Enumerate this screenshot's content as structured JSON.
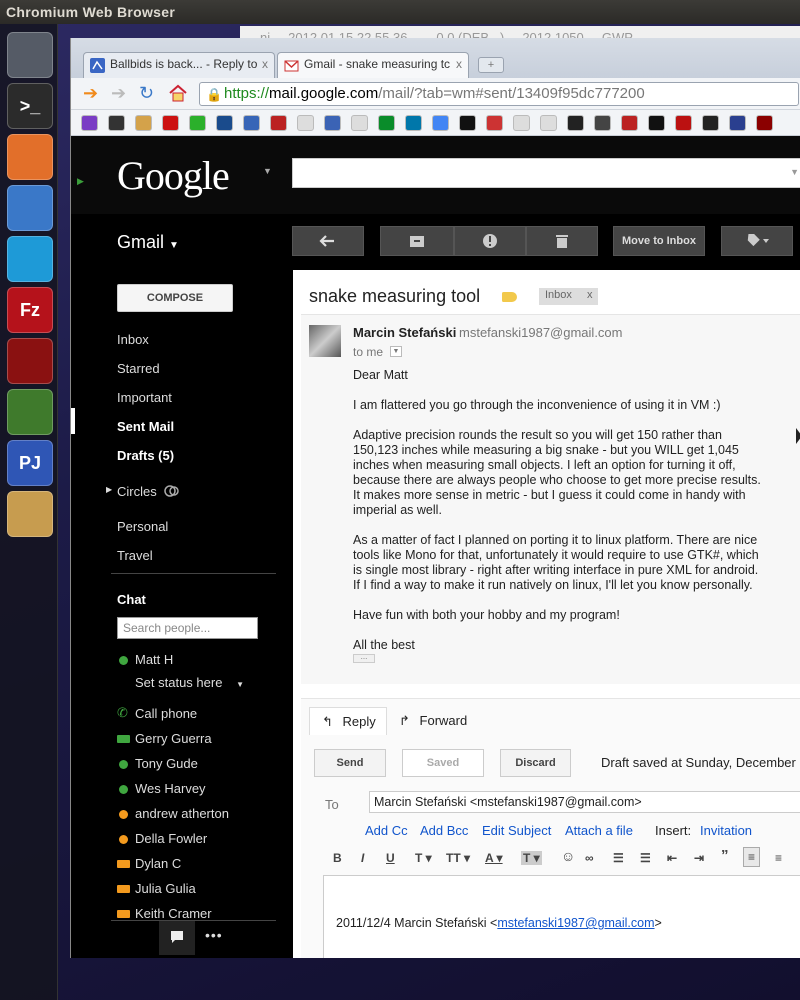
{
  "desktop": {
    "panel_title": "Chromium Web Browser",
    "launcher": [
      {
        "name": "ubuntu-dash-icon",
        "color": "#555b66"
      },
      {
        "name": "terminal-icon",
        "color": "#2b2b2b"
      },
      {
        "name": "home-folder-icon",
        "color": "#e26f2a"
      },
      {
        "name": "chromium-icon",
        "color": "#3a78c8"
      },
      {
        "name": "skype-icon",
        "color": "#1e9ad7"
      },
      {
        "name": "filezilla-icon",
        "color": "#b5121b"
      },
      {
        "name": "crossover-icon",
        "color": "#8a1111"
      },
      {
        "name": "josm-icon",
        "color": "#3f7a2c"
      },
      {
        "name": "pj64-icon",
        "color": "#2f56b5"
      },
      {
        "name": "gimp-icon",
        "color": "#c79c4f"
      }
    ],
    "launcher_labels": {
      "terminal": ">_",
      "filezilla": "Fz",
      "pj64": "PJ"
    },
    "bg_window_text": "ni ... 2012 01 15 22 55 36 ...... 0.0 (DEB...) ... 2012 1050 ... GWP"
  },
  "browser": {
    "tabs": [
      {
        "title": "Ballbids is back... - Reply to",
        "close": "x",
        "active": false
      },
      {
        "title": "Gmail - snake measuring tc",
        "close": "x",
        "active": true
      }
    ],
    "url": {
      "scheme": "https://",
      "host": "mail.google.com",
      "path": "/mail/?tab=wm#sent/13409f95dc777200"
    },
    "bookmark_colors": [
      "#7a3cc4",
      "#333",
      "#d4a24a",
      "#cc1111",
      "#2bb02b",
      "#1a4b8c",
      "#3765b7",
      "#b22",
      "#ddd",
      "#3b63b5",
      "#ddd",
      "#0a8c2a",
      "#07a",
      "#4285f4",
      "#111",
      "#c33",
      "#ddd",
      "#ddd",
      "#222",
      "#444",
      "#b22",
      "#111",
      "#b11",
      "#222",
      "#2a3f8f",
      "#8b0000"
    ]
  },
  "gmail": {
    "logo": "Google",
    "app_name": "Gmail",
    "search_placeholder": "",
    "actions": {
      "reply_icon": "reply-icon",
      "archive_icon": "archive-icon",
      "spam_icon": "report-spam-icon",
      "delete_icon": "delete-icon",
      "move_to_inbox": "Move to Inbox",
      "labels_icon": "label-tag-icon"
    },
    "nav": {
      "compose": "COMPOSE",
      "items": [
        {
          "label": "Inbox"
        },
        {
          "label": "Starred"
        },
        {
          "label": "Important"
        },
        {
          "label": "Sent Mail"
        },
        {
          "label": "Drafts (5)"
        },
        {
          "label": "Circles"
        },
        {
          "label": "Personal"
        },
        {
          "label": "Travel"
        }
      ],
      "chat_title": "Chat",
      "chat_search_placeholder": "Search people...",
      "self_name": "Matt H",
      "set_status": "Set status here",
      "call_phone": "Call phone",
      "contacts": [
        {
          "name": "Gerry Guerra",
          "status": "video-green"
        },
        {
          "name": "Tony Gude",
          "status": "green"
        },
        {
          "name": "Wes Harvey",
          "status": "green"
        },
        {
          "name": "andrew atherton",
          "status": "orange"
        },
        {
          "name": "Della Fowler",
          "status": "orange"
        },
        {
          "name": "Dylan C",
          "status": "video-orange"
        },
        {
          "name": "Julia Gulia",
          "status": "video-orange"
        },
        {
          "name": "Keith Cramer",
          "status": "video-orange"
        }
      ]
    },
    "message": {
      "subject": "snake measuring tool",
      "label_chip": "Inbox",
      "label_chip_close": "x",
      "sender_name": "Marcin Stefański",
      "sender_email": "mstefanski1987@gmail.com",
      "to": "to me",
      "body": [
        "Dear Matt",
        "I am flattered you go through the inconvenience of using it in VM :)",
        "Adaptive precision rounds the result so you will get 150 rather than 150,123 inches while measuring a big snake - but you WILL get 1,045 inches when measuring small objects. I left an option for turning it off, because there are always people who choose to get more precise results. It makes more sense in metric - but I guess it could come in handy with imperial as well.",
        "As a matter of fact I planned on porting it to linux platform. There are nice tools like Mono for that, unfortunately it would require to use GTK#, which is single most library - right after writing interface in pure XML for android. If I find a way to make it run natively on linux, I'll let you know personally.",
        "Have fun with both your hobby and my program!",
        "All the best"
      ]
    },
    "reply": {
      "tab_reply": "Reply",
      "tab_forward": "Forward",
      "send": "Send",
      "saved": "Saved",
      "discard": "Discard",
      "draft_status": "Draft saved at Sunday, December",
      "to_label": "To",
      "to_value": "Marcin Stefański <mstefanski1987@gmail.com>",
      "add_cc": "Add Cc",
      "add_bcc": "Add Bcc",
      "edit_subject": "Edit Subject",
      "attach": "Attach a file",
      "insert_label": "Insert:",
      "invitation": "Invitation",
      "quote_prefix": "2011/12/4 Marcin Stefański <",
      "quote_email": "mstefanski1987@gmail.com",
      "quote_suffix": ">"
    }
  }
}
